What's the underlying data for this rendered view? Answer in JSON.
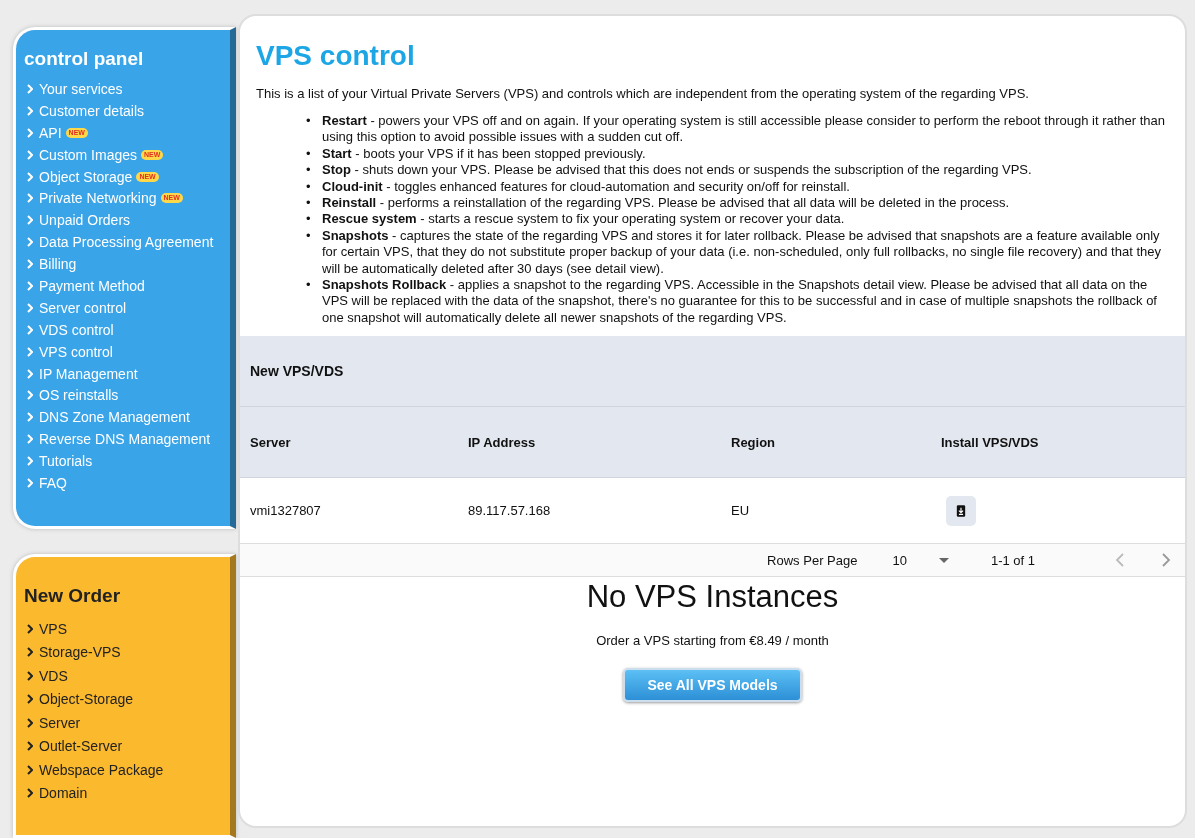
{
  "control_panel": {
    "title": "control panel",
    "items": [
      {
        "label": "Your services"
      },
      {
        "label": "Customer details"
      },
      {
        "label": "API",
        "badge": "NEW"
      },
      {
        "label": "Custom Images",
        "badge": "NEW"
      },
      {
        "label": "Object Storage",
        "badge": "NEW"
      },
      {
        "label": "Private Networking",
        "badge": "NEW"
      },
      {
        "label": "Unpaid Orders"
      },
      {
        "label": "Data Processing Agreement"
      },
      {
        "label": "Billing"
      },
      {
        "label": "Payment Method"
      },
      {
        "label": "Server control"
      },
      {
        "label": "VDS control"
      },
      {
        "label": "VPS control"
      },
      {
        "label": "IP Management"
      },
      {
        "label": "OS reinstalls"
      },
      {
        "label": "DNS Zone Management"
      },
      {
        "label": "Reverse DNS Management"
      },
      {
        "label": "Tutorials"
      },
      {
        "label": "FAQ"
      }
    ]
  },
  "new_order": {
    "title": "New Order",
    "items": [
      {
        "label": "VPS"
      },
      {
        "label": "Storage-VPS"
      },
      {
        "label": "VDS"
      },
      {
        "label": "Object-Storage"
      },
      {
        "label": "Server"
      },
      {
        "label": "Outlet-Server"
      },
      {
        "label": "Webspace Package"
      },
      {
        "label": "Domain"
      }
    ]
  },
  "page": {
    "title": "VPS control",
    "intro": "This is a list of your Virtual Private Servers (VPS) and controls which are independent from the operating system of the regarding VPS.",
    "bullets": [
      {
        "marker": "•",
        "term": "Restart",
        "text": " - powers your VPS off and on again. If your operating system is still accessible please consider to perform the reboot through it rather than using this option to avoid possible issues with a sudden cut off."
      },
      {
        "marker": "•",
        "term": "Start",
        "text": " - boots your VPS if it has been stopped previously."
      },
      {
        "marker": "•",
        "term": "Stop",
        "text": " - shuts down your VPS. Please be advised that this does not ends or suspends the subscription of the regarding VPS."
      },
      {
        "marker": "•",
        "term": "Cloud-init",
        "text": " - toggles enhanced features for cloud-automation and security on/off for reinstall."
      },
      {
        "marker": "•",
        "term": "Reinstall",
        "text": " - performs a reinstallation of the regarding VPS. Please be advised that all data will be deleted in the process."
      },
      {
        "marker": "•",
        "term": "Rescue system",
        "text": " - starts a rescue system to fix your operating system or recover your data."
      },
      {
        "marker": "•",
        "term": "Snapshots",
        "text": " - captures the state of the regarding VPS and stores it for later rollback. Please be advised that snapshots are a feature available only for certain VPS, that they do not substitute proper backup of your data (i.e. non-scheduled, only full rollbacks, no single file recovery) and that they will be automatically deleted after 30 days (see detail view)."
      },
      {
        "marker": "•",
        "term": "Snapshots Rollback",
        "text": " - applies a snapshot to the regarding VPS. Accessible in the Snapshots detail view. Please be advised that all data on the VPS will be replaced with the data of the snapshot, there's no guarantee for this to be successful and in case of multiple snapshots the rollback of one snapshot will automatically delete all newer snapshots of the regarding VPS."
      }
    ]
  },
  "table": {
    "title": "New VPS/VDS",
    "columns": [
      "Server",
      "IP Address",
      "Region",
      "Install VPS/VDS"
    ],
    "rows": [
      {
        "server": "vmi1327807",
        "ip": "89.117.57.168",
        "region": "EU"
      }
    ],
    "pagination": {
      "rows_per_page_label": "Rows Per Page",
      "rows_per_page": "10",
      "range": "1-1 of 1"
    }
  },
  "empty_state": {
    "title": "No VPS Instances",
    "text": "Order a VPS starting from €8.49 / month",
    "button": "See All VPS Models"
  }
}
